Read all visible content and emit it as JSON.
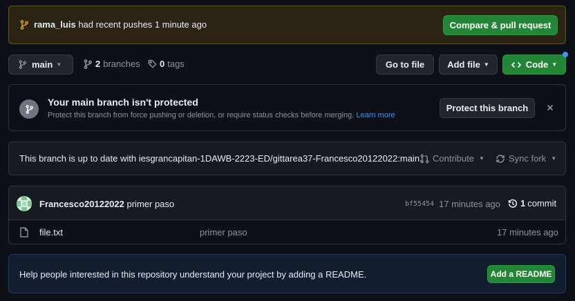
{
  "push_banner": {
    "user": "rama_luis",
    "message": "had recent pushes 1 minute ago",
    "button_label": "Compare & pull request"
  },
  "nav": {
    "branch_name": "main",
    "branches_count": "2",
    "branches_label": "branches",
    "tags_count": "0",
    "tags_label": "tags",
    "go_to_file_label": "Go to file",
    "add_file_label": "Add file",
    "code_label": "Code"
  },
  "protect_banner": {
    "title": "Your main branch isn't protected",
    "description": "Protect this branch from force pushing or deletion, or require status checks before merging.",
    "learn_more": "Learn more",
    "button_label": "Protect this branch"
  },
  "sync_bar": {
    "status": "This branch is up to date with iesgrancapitan-1DAWB-2223-ED/gittarea37-Francesco20122022:main.",
    "contribute_label": "Contribute",
    "sync_fork_label": "Sync fork"
  },
  "commit": {
    "author": "Francesco20122022",
    "message": "primer paso",
    "hash": "bf55454",
    "time": "17 minutes ago",
    "count": "1",
    "count_label": "commit"
  },
  "files": [
    {
      "name": "file.txt",
      "message": "primer paso",
      "time": "17 minutes ago"
    }
  ],
  "readme_banner": {
    "text": "Help people interested in this repository understand your project by adding a README.",
    "button_label": "Add a README"
  },
  "colors": {
    "background": "#0d1117",
    "accent_green": "#238636",
    "link_blue": "#4493f8",
    "banner_yellow_bg": "#2b2414",
    "banner_yellow_border": "#6b5217"
  }
}
